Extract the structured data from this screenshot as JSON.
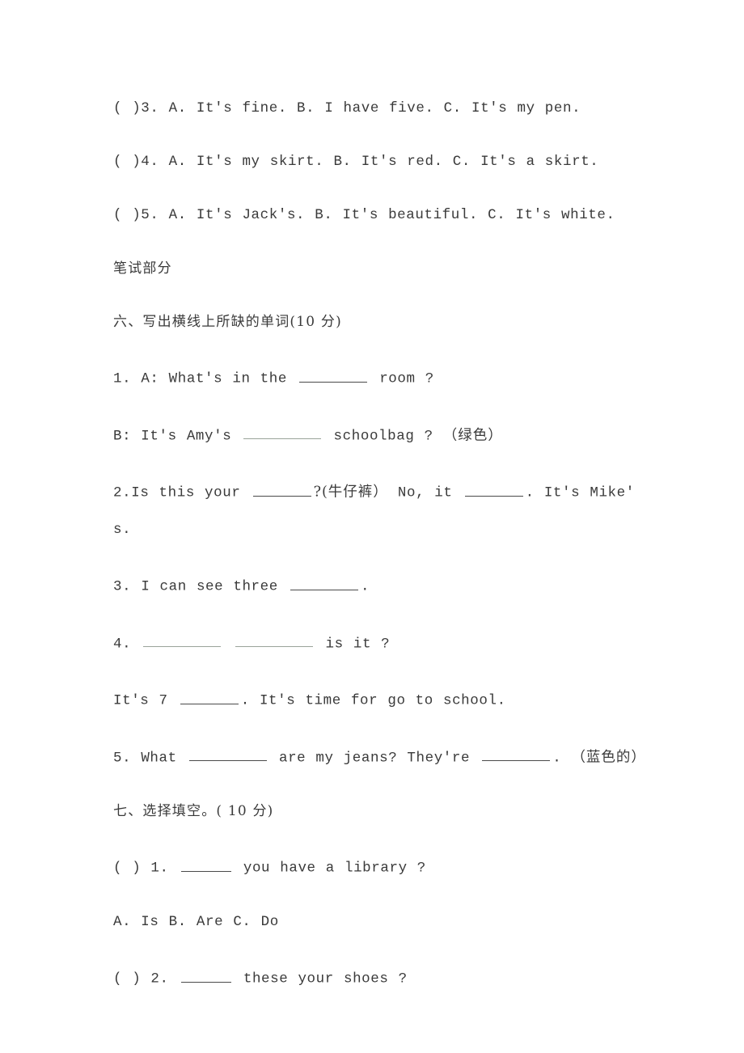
{
  "document": {
    "type": "english-exam-paper",
    "background_color": "#ffffff",
    "text_color": "#3a3a3a"
  },
  "listening_section": {
    "items": [
      {
        "marker": "( )3.",
        "text": "A. It's fine. B. I have five. C. It's my pen."
      },
      {
        "marker": "( )4.",
        "text": "A. It's my skirt. B. It's red. C. It's a skirt."
      },
      {
        "marker": "( )5.",
        "text": "A. It's Jack's. B. It's beautiful. C. It's white."
      }
    ]
  },
  "written_heading": "笔试部分",
  "section_six": {
    "heading": "六、写出横线上所缺的单词(10 分)",
    "q1": {
      "number": "1.",
      "a_label": "A: What's in the",
      "a_tail": "room ?",
      "b_label": "B: It's Amy's",
      "b_mid": "schoolbag ?",
      "b_hint": "（绿色）"
    },
    "q2": {
      "number": "2.",
      "part1": "Is this your",
      "hint1": "?(牛仔裤）",
      "part2": "No, it",
      "part3": ". It's Mike'",
      "part4": "s."
    },
    "q3": {
      "number": "3.",
      "text": "I can see three",
      "tail": "."
    },
    "q4": {
      "number": "4.",
      "tail": "is it ?",
      "line2_pre": "It's 7",
      "line2_post": ". It's time for go to school."
    },
    "q5": {
      "number": "5.",
      "pre": "What",
      "mid": "are my jeans? They're",
      "post": ".",
      "hint": "（蓝色的）"
    }
  },
  "section_seven": {
    "heading": "七、选择填空。( 10 分)",
    "q1": {
      "marker": "( ) 1.",
      "text": "you have a library ?",
      "options": "A. Is B. Are C. Do"
    },
    "q2": {
      "marker": "( ) 2.",
      "text": "these your shoes ?"
    }
  }
}
